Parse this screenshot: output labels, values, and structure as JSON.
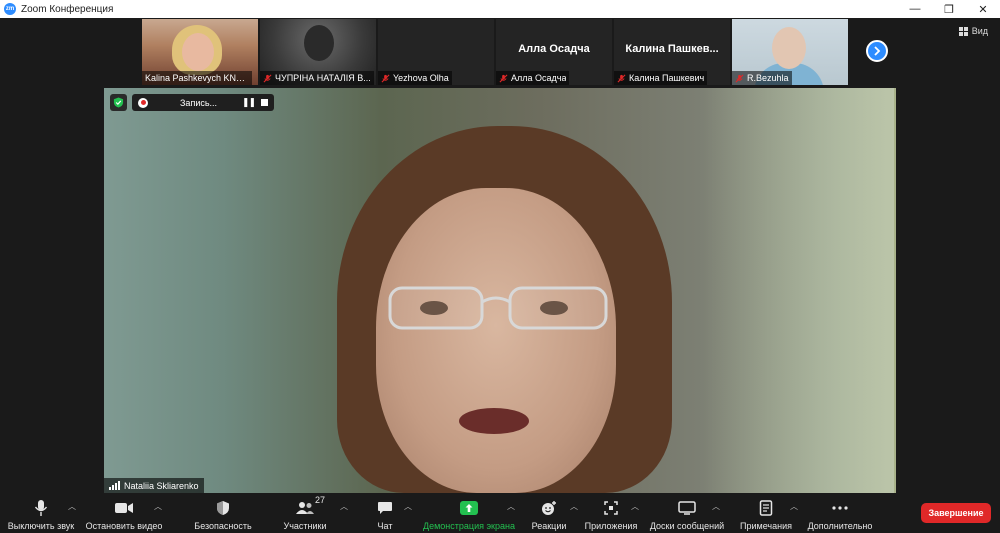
{
  "window": {
    "logo": "zm",
    "title": "Zoom Конференция",
    "controls": [
      "—",
      "❐",
      "✕"
    ]
  },
  "view_button": {
    "label": "Вид",
    "icon": "grid-icon"
  },
  "thumbnails": [
    {
      "name": "Kalina Pashkevych KNUT...",
      "muted": false,
      "has_video": true
    },
    {
      "name": "ЧУПРІНА НАТАЛІЯ В...",
      "muted": true,
      "has_video": true
    },
    {
      "name": "Yezhova Olha",
      "muted": true,
      "has_video": false
    },
    {
      "name": "Алла Осадча",
      "big_name": "Алла Осадча",
      "muted": true,
      "has_video": false
    },
    {
      "name": "Калина Пашкевич",
      "big_name": "Калина  Пашкев...",
      "muted": true,
      "has_video": false
    },
    {
      "name": "R.Bezuhla",
      "muted": true,
      "has_video": true
    }
  ],
  "next_page_icon": "chevron-right-icon",
  "main_video": {
    "speaker": "Nataliia Skliarenko",
    "recording_label": "Запись...",
    "security_icon": "shield-check-icon"
  },
  "toolbar": {
    "mute": "Выключить звук",
    "video": "Остановить видео",
    "security": "Безопасность",
    "participants": "Участники",
    "participants_count": "27",
    "chat": "Чат",
    "share": "Демонстрация экрана",
    "reactions": "Реакции",
    "apps": "Приложения",
    "whiteboards": "Доски сообщений",
    "notes": "Примечания",
    "more": "Дополнительно",
    "end": "Завершение"
  },
  "colors": {
    "accent": "#2d8cff",
    "share_green": "#23c050",
    "end_red": "#e02828",
    "muted_red": "#e02828"
  }
}
